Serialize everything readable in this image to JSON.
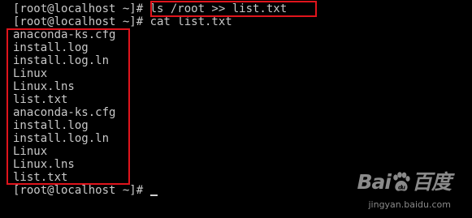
{
  "terminal": {
    "lines": [
      "[root@localhost ~]# ls /root >> list.txt",
      "[root@localhost ~]# cat list.txt",
      "anaconda-ks.cfg",
      "install.log",
      "install.log.ln",
      "Linux",
      "Linux.lns",
      "list.txt",
      "anaconda-ks.cfg",
      "install.log",
      "install.log.ln",
      "Linux",
      "Linux.lns",
      "list.txt",
      "[root@localhost ~]# "
    ],
    "text_color": "#c8c8c8",
    "background": "#000000",
    "highlight_color": "#e0141c"
  },
  "watermark": {
    "logo_left": "Bai",
    "logo_right": "百度",
    "logo_icon": "paw-icon",
    "subtext": "jingyan.baidu.com"
  }
}
